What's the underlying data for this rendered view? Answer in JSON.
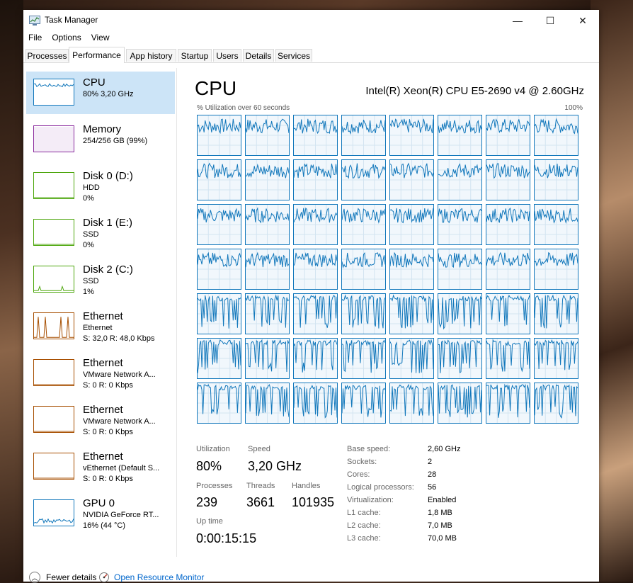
{
  "window": {
    "title": "Task Manager",
    "minimize_glyph": "—",
    "maximize_glyph": "☐",
    "close_glyph": "✕"
  },
  "menu": [
    "File",
    "Options",
    "View"
  ],
  "tabs": [
    "Processes",
    "Performance",
    "App history",
    "Startup",
    "Users",
    "Details",
    "Services"
  ],
  "sidebar": [
    {
      "name": "CPU",
      "lines": [
        "80% 3,20 GHz"
      ],
      "color": "#1177bb",
      "kind": "cpu"
    },
    {
      "name": "Memory",
      "lines": [
        "254/256 GB (99%)"
      ],
      "color": "#8b2c9e",
      "kind": "mem"
    },
    {
      "name": "Disk 0 (D:)",
      "lines": [
        "HDD",
        "0%"
      ],
      "color": "#4da60c",
      "kind": "flat"
    },
    {
      "name": "Disk 1 (E:)",
      "lines": [
        "SSD",
        "0%"
      ],
      "color": "#4da60c",
      "kind": "flat"
    },
    {
      "name": "Disk 2 (C:)",
      "lines": [
        "SSD",
        "1%"
      ],
      "color": "#4da60c",
      "kind": "disk"
    },
    {
      "name": "Ethernet",
      "lines": [
        "Ethernet",
        "S: 32,0 R: 48,0 Kbps"
      ],
      "color": "#a74f01",
      "kind": "eth"
    },
    {
      "name": "Ethernet",
      "lines": [
        "VMware Network A...",
        "S: 0 R: 0 Kbps"
      ],
      "color": "#a74f01",
      "kind": "flat"
    },
    {
      "name": "Ethernet",
      "lines": [
        "VMware Network A...",
        "S: 0 R: 0 Kbps"
      ],
      "color": "#a74f01",
      "kind": "flat"
    },
    {
      "name": "Ethernet",
      "lines": [
        "vEthernet (Default S...",
        "S: 0 R: 0 Kbps"
      ],
      "color": "#a74f01",
      "kind": "flat"
    },
    {
      "name": "GPU 0",
      "lines": [
        "NVIDIA GeForce RT...",
        "16% (44 °C)"
      ],
      "color": "#1177bb",
      "kind": "gpu"
    }
  ],
  "cpu": {
    "title": "CPU",
    "model": "Intel(R) Xeon(R) CPU E5-2690 v4 @ 2.60GHz",
    "graph_label": "% Utilization over 60 seconds",
    "graph_max": "100%",
    "line_color": "#1177bb",
    "stats": {
      "utilization_label": "Utilization",
      "utilization": "80%",
      "speed_label": "Speed",
      "speed": "3,20 GHz",
      "processes_label": "Processes",
      "processes": "239",
      "threads_label": "Threads",
      "threads": "3661",
      "handles_label": "Handles",
      "handles": "101935",
      "uptime_label": "Up time",
      "uptime": "0:00:15:15"
    },
    "specs": [
      {
        "label": "Base speed:",
        "value": "2,60 GHz"
      },
      {
        "label": "Sockets:",
        "value": "2"
      },
      {
        "label": "Cores:",
        "value": "28"
      },
      {
        "label": "Logical processors:",
        "value": "56"
      },
      {
        "label": "Virtualization:",
        "value": "Enabled"
      },
      {
        "label": "L1 cache:",
        "value": "1,8 MB"
      },
      {
        "label": "L2 cache:",
        "value": "7,0 MB"
      },
      {
        "label": "L3 cache:",
        "value": "70,0 MB"
      }
    ]
  },
  "footer": {
    "fewer_details": "Fewer details",
    "open_resource_monitor": "Open Resource Monitor"
  }
}
